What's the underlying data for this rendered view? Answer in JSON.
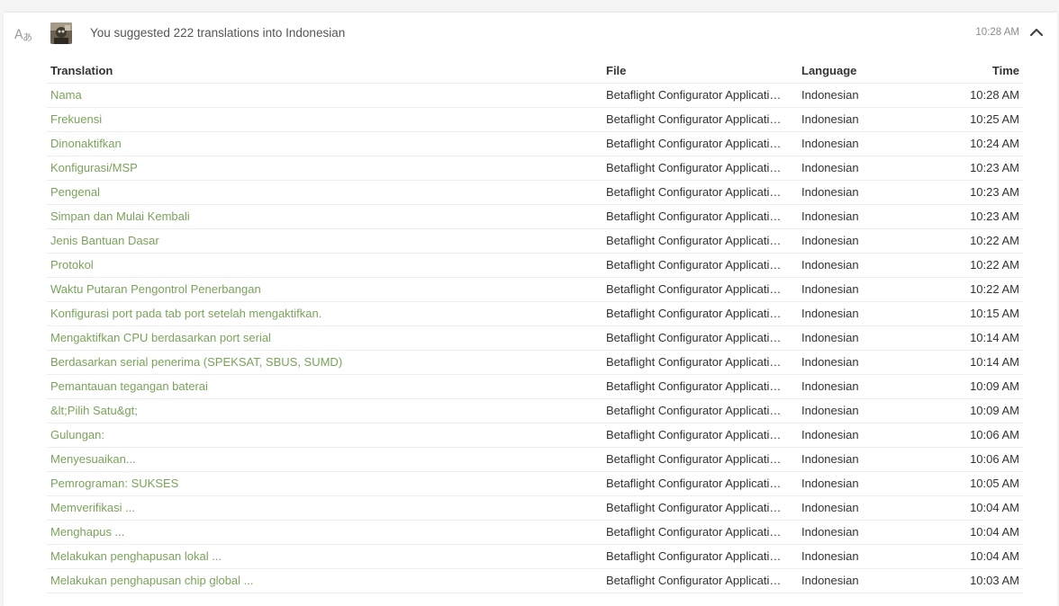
{
  "activity": {
    "summary": "You suggested 222 translations into Indonesian",
    "time": "10:28 AM",
    "icon": "translate-icon",
    "toggle_icon": "chevron-up-icon",
    "accent_color": "#7aa35a"
  },
  "table": {
    "columns": [
      "Translation",
      "File",
      "Language",
      "Time"
    ],
    "rows": [
      {
        "translation": "Nama",
        "file": "Betaflight Configurator Applicati…",
        "language": "Indonesian",
        "time": "10:28 AM"
      },
      {
        "translation": "Frekuensi",
        "file": "Betaflight Configurator Applicati…",
        "language": "Indonesian",
        "time": "10:25 AM"
      },
      {
        "translation": "Dinonaktifkan",
        "file": "Betaflight Configurator Applicati…",
        "language": "Indonesian",
        "time": "10:24 AM"
      },
      {
        "translation": "Konfigurasi/MSP",
        "file": "Betaflight Configurator Applicati…",
        "language": "Indonesian",
        "time": "10:23 AM"
      },
      {
        "translation": "Pengenal",
        "file": "Betaflight Configurator Applicati…",
        "language": "Indonesian",
        "time": "10:23 AM"
      },
      {
        "translation": "Simpan dan Mulai Kembali",
        "file": "Betaflight Configurator Applicati…",
        "language": "Indonesian",
        "time": "10:23 AM"
      },
      {
        "translation": "Jenis Bantuan Dasar",
        "file": "Betaflight Configurator Applicati…",
        "language": "Indonesian",
        "time": "10:22 AM"
      },
      {
        "translation": "Protokol",
        "file": "Betaflight Configurator Applicati…",
        "language": "Indonesian",
        "time": "10:22 AM"
      },
      {
        "translation": "Waktu Putaran Pengontrol Penerbangan",
        "file": "Betaflight Configurator Applicati…",
        "language": "Indonesian",
        "time": "10:22 AM"
      },
      {
        "translation": "Konfigurasi port pada tab port setelah mengaktifkan.",
        "file": "Betaflight Configurator Applicati…",
        "language": "Indonesian",
        "time": "10:15 AM"
      },
      {
        "translation": "Mengaktifkan CPU berdasarkan port serial",
        "file": "Betaflight Configurator Applicati…",
        "language": "Indonesian",
        "time": "10:14 AM"
      },
      {
        "translation": "Berdasarkan serial penerima (SPEKSAT, SBUS, SUMD)",
        "file": "Betaflight Configurator Applicati…",
        "language": "Indonesian",
        "time": "10:14 AM"
      },
      {
        "translation": "Pemantauan tegangan baterai",
        "file": "Betaflight Configurator Applicati…",
        "language": "Indonesian",
        "time": "10:09 AM"
      },
      {
        "translation": "&lt;Pilih Satu&gt;",
        "file": "Betaflight Configurator Applicati…",
        "language": "Indonesian",
        "time": "10:09 AM"
      },
      {
        "translation": "Gulungan:",
        "file": "Betaflight Configurator Applicati…",
        "language": "Indonesian",
        "time": "10:06 AM"
      },
      {
        "translation": "Menyesuaikan...",
        "file": "Betaflight Configurator Applicati…",
        "language": "Indonesian",
        "time": "10:06 AM"
      },
      {
        "translation": "Pemrograman: SUKSES",
        "file": "Betaflight Configurator Applicati…",
        "language": "Indonesian",
        "time": "10:05 AM"
      },
      {
        "translation": "Memverifikasi ...",
        "file": "Betaflight Configurator Applicati…",
        "language": "Indonesian",
        "time": "10:04 AM"
      },
      {
        "translation": "Menghapus ...",
        "file": "Betaflight Configurator Applicati…",
        "language": "Indonesian",
        "time": "10:04 AM"
      },
      {
        "translation": "Melakukan penghapusan lokal ...",
        "file": "Betaflight Configurator Applicati…",
        "language": "Indonesian",
        "time": "10:04 AM"
      },
      {
        "translation": "Melakukan penghapusan chip global ...",
        "file": "Betaflight Configurator Applicati…",
        "language": "Indonesian",
        "time": "10:03 AM"
      }
    ]
  }
}
